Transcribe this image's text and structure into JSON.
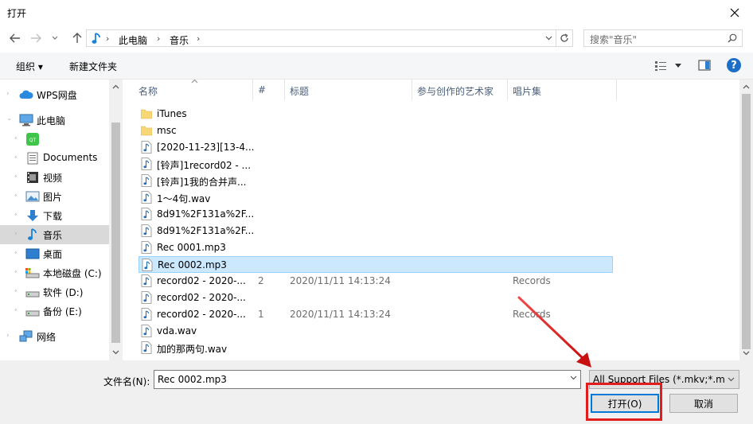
{
  "window": {
    "title": "打开"
  },
  "address": {
    "crumbs": [
      "此电脑",
      "音乐"
    ]
  },
  "search": {
    "placeholder": "搜索\"音乐\""
  },
  "toolbar": {
    "organize": "组织 ▾",
    "new_folder": "新建文件夹"
  },
  "sidebar": {
    "items": [
      {
        "label": "WPS网盘"
      },
      {
        "label": "此电脑"
      },
      {
        "label": ""
      },
      {
        "label": "Documents"
      },
      {
        "label": "视频"
      },
      {
        "label": "图片"
      },
      {
        "label": "下载"
      },
      {
        "label": "音乐"
      },
      {
        "label": "桌面"
      },
      {
        "label": "本地磁盘 (C:)"
      },
      {
        "label": "软件 (D:)"
      },
      {
        "label": "备份 (E:)"
      },
      {
        "label": "网络"
      }
    ]
  },
  "columns": [
    "名称",
    "#",
    "标题",
    "参与创作的艺术家",
    "唱片集"
  ],
  "files": [
    {
      "name": "iTunes",
      "type": "folder",
      "num": "",
      "date": "",
      "album": ""
    },
    {
      "name": "msc",
      "type": "folder",
      "num": "",
      "date": "",
      "album": ""
    },
    {
      "name": "[2020-11-23][13-4...",
      "type": "audio",
      "num": "",
      "date": "",
      "album": ""
    },
    {
      "name": "[铃声]1record02 - ...",
      "type": "audio",
      "num": "",
      "date": "",
      "album": ""
    },
    {
      "name": "[铃声]1我的合并声...",
      "type": "audio",
      "num": "",
      "date": "",
      "album": ""
    },
    {
      "name": "1～4句.wav",
      "type": "audio",
      "num": "",
      "date": "",
      "album": ""
    },
    {
      "name": "8d91%2F131a%2F...",
      "type": "audio",
      "num": "",
      "date": "",
      "album": ""
    },
    {
      "name": "8d91%2F131a%2F...",
      "type": "audio",
      "num": "",
      "date": "",
      "album": ""
    },
    {
      "name": "Rec 0001.mp3",
      "type": "audio",
      "num": "",
      "date": "",
      "album": ""
    },
    {
      "name": "Rec 0002.mp3",
      "type": "audio",
      "num": "",
      "date": "",
      "album": ""
    },
    {
      "name": "record02 - 2020-...",
      "type": "audio",
      "num": "2",
      "date": "2020/11/11 14:13:24",
      "album": "Records"
    },
    {
      "name": "record02 - 2020-...",
      "type": "audio",
      "num": "",
      "date": "",
      "album": ""
    },
    {
      "name": "record02 - 2020-...",
      "type": "audio",
      "num": "1",
      "date": "2020/11/11 14:13:24",
      "album": "Records"
    },
    {
      "name": "vda.wav",
      "type": "audio",
      "num": "",
      "date": "",
      "album": ""
    },
    {
      "name": "加的那两句.wav",
      "type": "audio",
      "num": "",
      "date": "",
      "album": ""
    }
  ],
  "bottom": {
    "filename_label": "文件名(N):",
    "filename_value": "Rec 0002.mp3",
    "filter_value": "All Support Files (*.mkv;*.mk",
    "open_label": "打开(O)",
    "cancel_label": "取消"
  },
  "colors": {
    "accent": "#0078d7",
    "selection": "#cce8ff",
    "annotation": "#e11d1d",
    "help": "#1c6fc7"
  }
}
